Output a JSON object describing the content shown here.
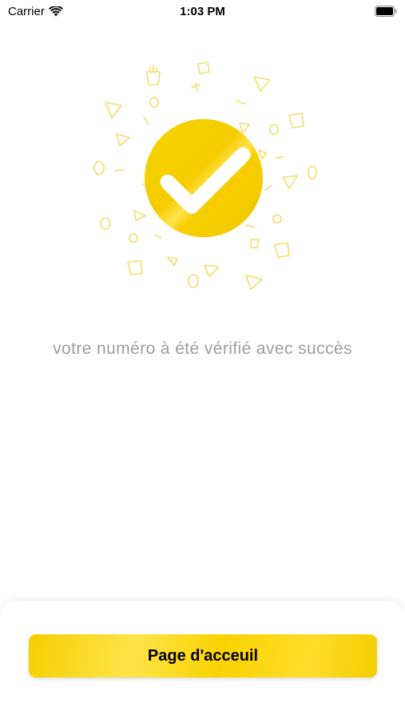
{
  "status_bar": {
    "carrier": "Carrier",
    "time": "1:03 PM",
    "wifi_icon": "wifi-icon",
    "battery_icon": "battery-icon"
  },
  "illustration": {
    "icon": "check-circle-icon",
    "accent_color": "#F5CF00",
    "decor_color": "#F7E27A"
  },
  "message": "votre numéro à été vérifié avec succès",
  "home_button": {
    "label": "Page d'acceuil",
    "color": "#F9D300"
  }
}
